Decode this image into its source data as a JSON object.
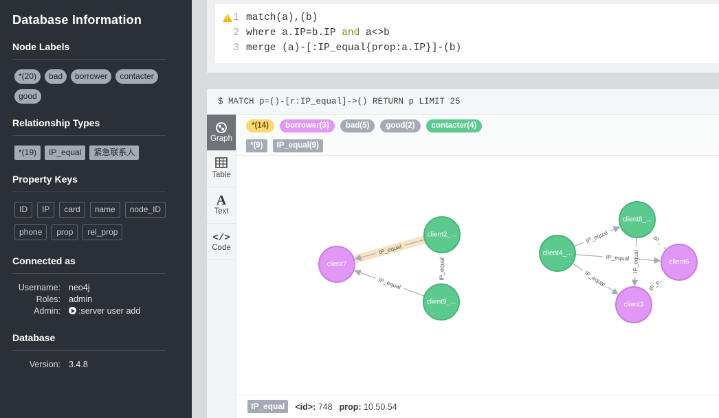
{
  "sidebar": {
    "title": "Database Information",
    "node_labels": {
      "heading": "Node Labels",
      "items": [
        "*(20)",
        "bad",
        "borrower",
        "contacter",
        "good"
      ]
    },
    "rel_types": {
      "heading": "Relationship Types",
      "items": [
        "*(19)",
        "IP_equal",
        "紧急联系人"
      ]
    },
    "prop_keys": {
      "heading": "Property Keys",
      "items": [
        "ID",
        "IP",
        "card",
        "name",
        "node_ID",
        "phone",
        "prop",
        "rel_prop"
      ]
    },
    "connected": {
      "heading": "Connected as",
      "username_label": "Username:",
      "username": "neo4j",
      "roles_label": "Roles:",
      "roles": "admin",
      "admin_label": "Admin:",
      "admin": ":server user add"
    },
    "database": {
      "heading": "Database",
      "version_label": "Version:",
      "version": "3.4.8"
    }
  },
  "editor": {
    "lines": [
      {
        "num": "1",
        "parts": [
          [
            "tx",
            "match(a),(b)"
          ]
        ]
      },
      {
        "num": "2",
        "parts": [
          [
            "tx",
            "where a.IP=b.IP "
          ],
          [
            "kw",
            "and"
          ],
          [
            "tx",
            " a<>b"
          ]
        ]
      },
      {
        "num": "3",
        "parts": [
          [
            "tx",
            "merge (a)-[:IP_equal{prop:a.IP}]-(b)"
          ]
        ]
      }
    ]
  },
  "result": {
    "query": "$ MATCH p=()-[r:IP_equal]->() RETURN p LIMIT 25",
    "tabs": [
      {
        "label": "Graph",
        "icon": "graph-icon"
      },
      {
        "label": "Table",
        "icon": "table-icon"
      },
      {
        "label": "Text",
        "icon": "text-icon"
      },
      {
        "label": "Code",
        "icon": "code-icon"
      }
    ],
    "node_tags": [
      {
        "label": "*(14)",
        "color": "#fcd871",
        "text": "#6b5710"
      },
      {
        "label": "borrower(3)",
        "color": "#e197f5",
        "text": "#fff"
      },
      {
        "label": "bad(5)",
        "color": "#a5abb6",
        "text": "#fff"
      },
      {
        "label": "good(2)",
        "color": "#a5abb6",
        "text": "#fff"
      },
      {
        "label": "contacter(4)",
        "color": "#5cc98e",
        "text": "#fff"
      }
    ],
    "rel_tags": [
      "*(9)",
      "IP_equal(9)"
    ],
    "nodes": [
      {
        "id": "client2",
        "label": "client2_..."
      },
      {
        "id": "client7",
        "label": "client7"
      },
      {
        "id": "client9",
        "label": "client9_..."
      },
      {
        "id": "client8",
        "label": "client8_..."
      },
      {
        "id": "client4",
        "label": "client4_..."
      },
      {
        "id": "client6",
        "label": "client6"
      },
      {
        "id": "client3",
        "label": "client3"
      }
    ],
    "edge_label": "IP_equal",
    "edge_label_short": "IP_e...",
    "edge_label_tiny": "IP...",
    "status": {
      "rel": "IP_equal",
      "id_label": "<id>:",
      "id": "748",
      "prop_label": "prop:",
      "prop": "10.50.54"
    }
  }
}
